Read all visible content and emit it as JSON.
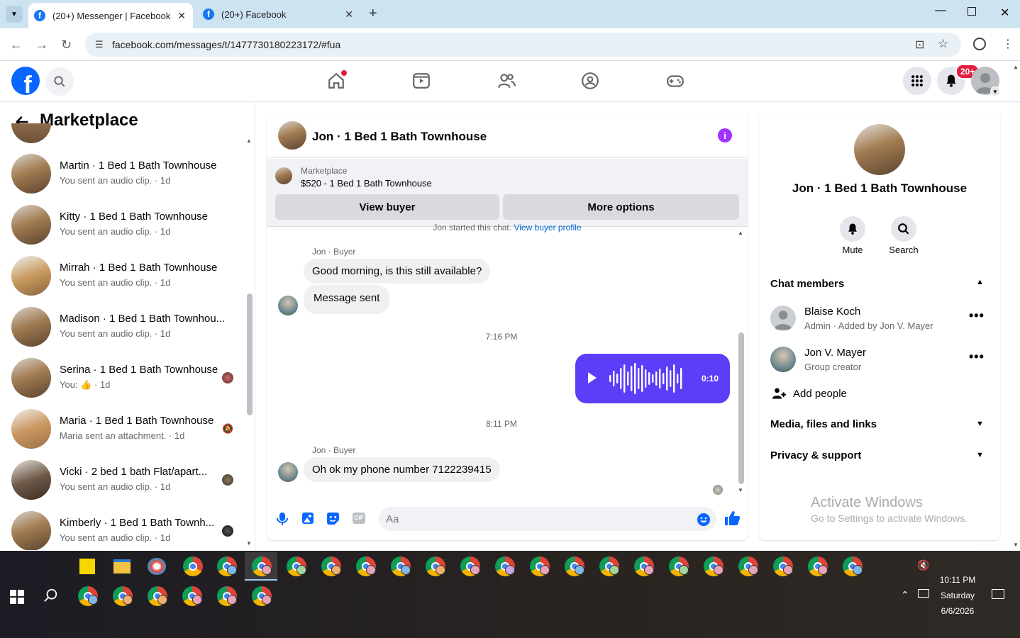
{
  "browser": {
    "tabs": [
      {
        "label": "(20+) Messenger | Facebook",
        "active": true
      },
      {
        "label": "(20+) Facebook",
        "active": false
      }
    ],
    "url": "facebook.com/messages/t/1477730180223172/#fua"
  },
  "fb_header": {
    "notification_badge": "20+",
    "accent": "#0866ff"
  },
  "left_panel": {
    "title": "Marketplace",
    "conversations": [
      {
        "name": "Martin · 1 Bed 1 Bath Townhouse",
        "preview": "You sent an audio clip. · 1d"
      },
      {
        "name": "Kitty · 1 Bed 1 Bath Townhouse",
        "preview": "You sent an audio clip. · 1d"
      },
      {
        "name": "Mirrah · 1 Bed 1 Bath Townhouse",
        "preview": "You sent an audio clip. · 1d"
      },
      {
        "name": "Madison · 1 Bed 1 Bath Townhou...",
        "preview": "You sent an audio clip. · 1d"
      },
      {
        "name": "Serina · 1 Bed 1 Bath Townhouse",
        "preview_prefix": "You:",
        "preview": "· 1d"
      },
      {
        "name": "Maria · 1 Bed 1 Bath Townhouse",
        "preview": "Maria sent an attachment. · 1d"
      },
      {
        "name": "Vicki · 2 bed 1 bath Flat/apart...",
        "preview": "You sent an audio clip. · 1d"
      },
      {
        "name": "Kimberly · 1 Bed 1 Bath Townh...",
        "preview": "You sent an audio clip. · 1d"
      }
    ]
  },
  "chat": {
    "title": "Jon · 1 Bed 1 Bath Townhouse",
    "marketplace": {
      "label": "Marketplace",
      "listing": "$520 - 1 Bed 1 Bath Townhouse",
      "view_buyer": "View buyer",
      "more_options": "More options"
    },
    "started_text": "Jon started this chat.",
    "started_link": "View buyer profile",
    "messages": [
      {
        "sender": "Jon · Buyer",
        "text": "Good morning, is this still available?"
      },
      {
        "text": "Message sent"
      }
    ],
    "timestamp1": "7:16 PM",
    "audio_duration": "0:10",
    "timestamp2": "8:11 PM",
    "messages2": [
      {
        "sender": "Jon · Buyer",
        "text": "Oh ok my phone number 7122239415"
      }
    ],
    "input_placeholder": "Aa",
    "brand_color": "#5b3ff8"
  },
  "right_panel": {
    "name": "Jon · 1 Bed 1 Bath Townhouse",
    "mute_label": "Mute",
    "search_label": "Search",
    "chat_members_label": "Chat members",
    "members": [
      {
        "name": "Blaise Koch",
        "role": "Admin · Added by Jon V. Mayer"
      },
      {
        "name": "Jon V. Mayer",
        "role": "Group creator"
      }
    ],
    "add_people": "Add people",
    "media_label": "Media, files and links",
    "privacy_label": "Privacy & support",
    "activate_title": "Activate Windows",
    "activate_sub": "Go to Settings to activate Windows."
  },
  "taskbar": {
    "time": "10:11 PM",
    "day": "Saturday",
    "date": "6/6/2026"
  }
}
